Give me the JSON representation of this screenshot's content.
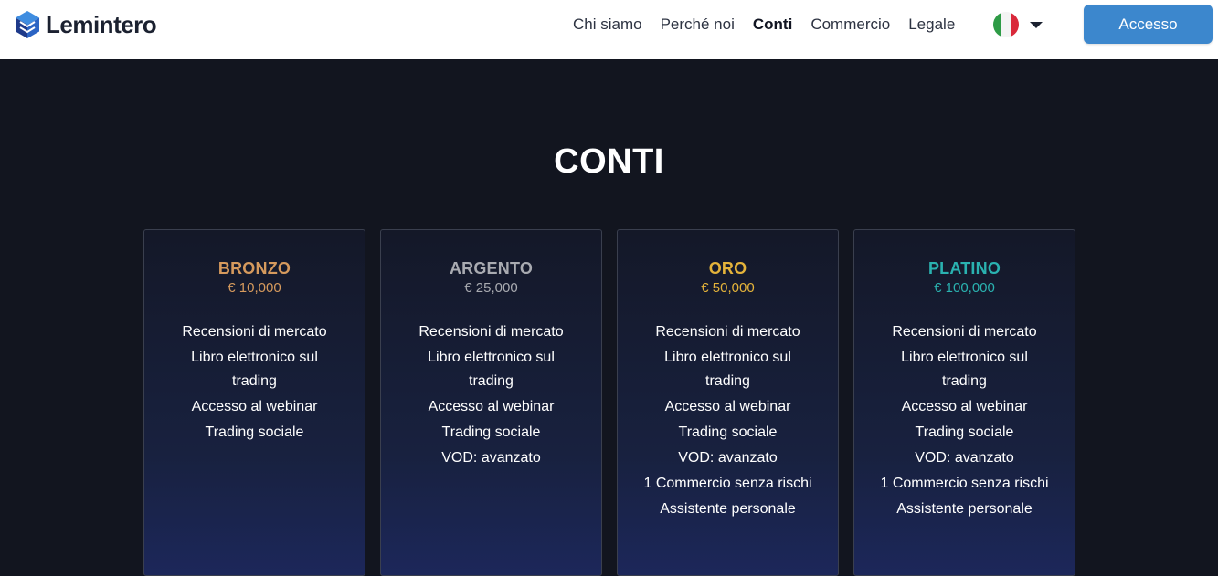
{
  "brand": {
    "name": "Lemintero"
  },
  "nav": {
    "items": [
      {
        "label": "Chi siamo",
        "active": false
      },
      {
        "label": "Perché noi",
        "active": false
      },
      {
        "label": "Conti",
        "active": true
      },
      {
        "label": "Commercio",
        "active": false
      },
      {
        "label": "Legale",
        "active": false
      }
    ],
    "language": {
      "icon": "italy-flag-icon"
    },
    "login_label": "Accesso"
  },
  "colors": {
    "header_bg": "#ffffff",
    "page_bg": "#12151f",
    "accent_button": "#3c87cd",
    "bronze": "#d69a5d",
    "silver": "#a9abb1",
    "gold": "#e4b33a",
    "platinum": "#2ab2b0"
  },
  "section": {
    "title": "CONTI"
  },
  "plans": [
    {
      "name": "BRONZO",
      "price": "€ 10,000",
      "color": "#d69a5d",
      "features": [
        "Recensioni di mercato",
        "Libro elettronico sul trading",
        "Accesso al webinar",
        "Trading sociale"
      ]
    },
    {
      "name": "ARGENTO",
      "price": "€ 25,000",
      "color": "#a9abb1",
      "features": [
        "Recensioni di mercato",
        "Libro elettronico sul trading",
        "Accesso al webinar",
        "Trading sociale",
        "VOD: avanzato"
      ]
    },
    {
      "name": "ORO",
      "price": "€ 50,000",
      "color": "#e4b33a",
      "features": [
        "Recensioni di mercato",
        "Libro elettronico sul trading",
        "Accesso al webinar",
        "Trading sociale",
        "VOD: avanzato",
        "1 Commercio senza rischi",
        "Assistente personale"
      ]
    },
    {
      "name": "PLATINO",
      "price": "€ 100,000",
      "color": "#2ab2b0",
      "features": [
        "Recensioni di mercato",
        "Libro elettronico sul trading",
        "Accesso al webinar",
        "Trading sociale",
        "VOD: avanzato",
        "1 Commercio senza rischi",
        "Assistente personale"
      ]
    }
  ]
}
